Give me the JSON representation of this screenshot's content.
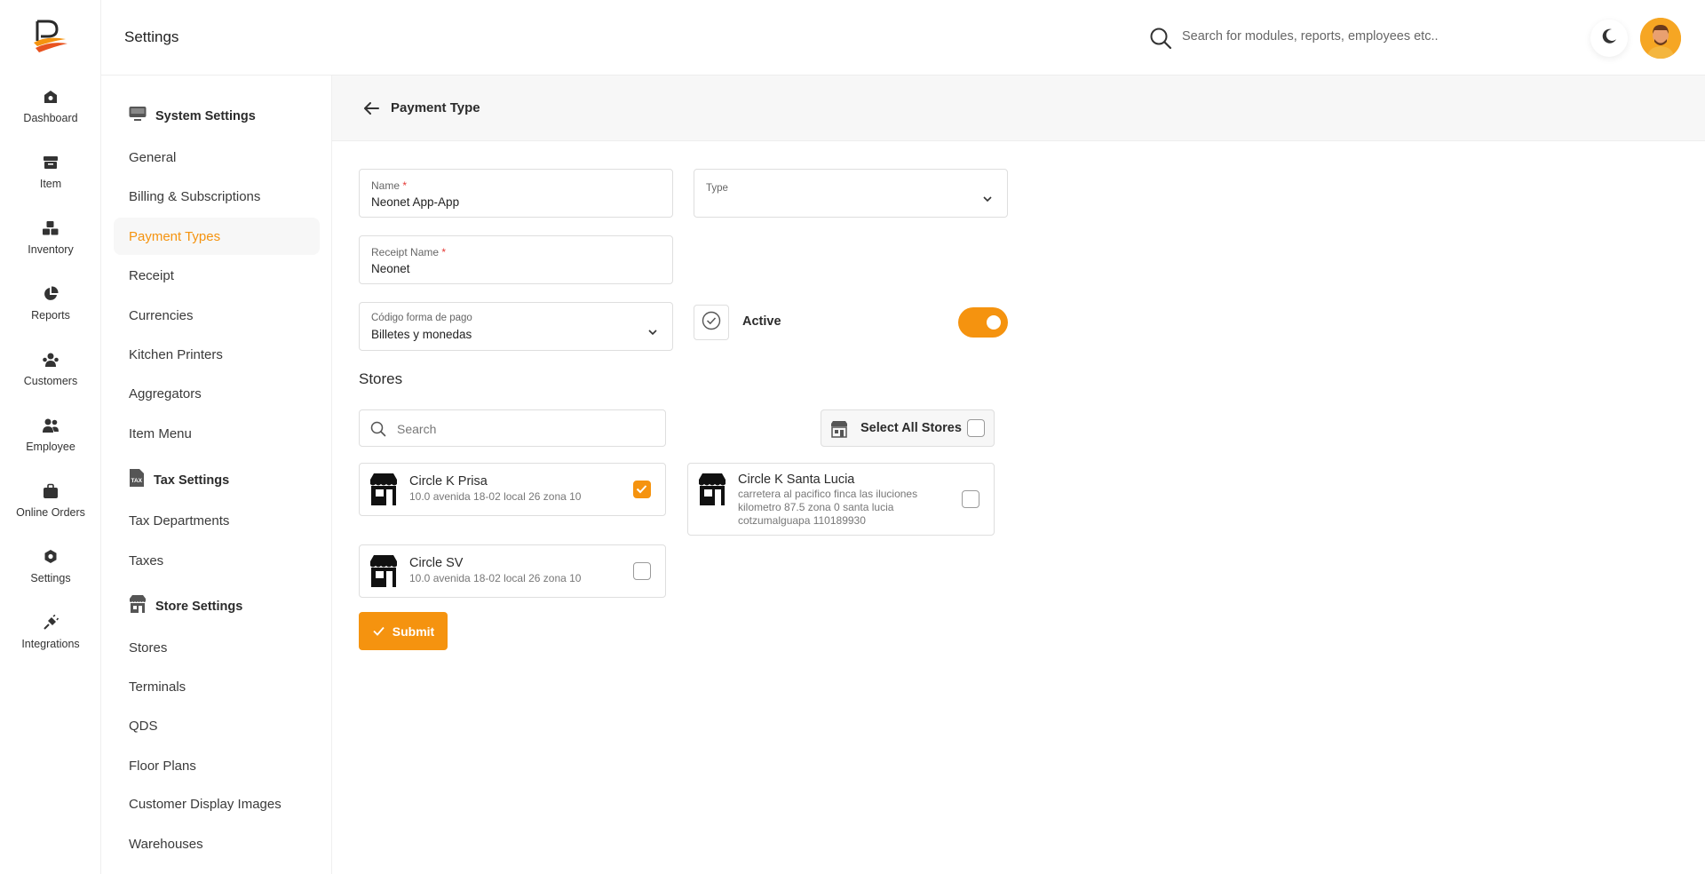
{
  "header": {
    "title": "Settings",
    "search_placeholder": "Search for modules, reports, employees etc.."
  },
  "rail": {
    "items": [
      {
        "label": "Dashboard",
        "icon": "dashboard-icon"
      },
      {
        "label": "Item",
        "icon": "item-icon"
      },
      {
        "label": "Inventory",
        "icon": "inventory-icon"
      },
      {
        "label": "Reports",
        "icon": "reports-icon"
      },
      {
        "label": "Customers",
        "icon": "customers-icon"
      },
      {
        "label": "Employee",
        "icon": "employee-icon"
      },
      {
        "label": "Online Orders",
        "icon": "online-orders-icon"
      },
      {
        "label": "Settings",
        "icon": "settings-icon"
      },
      {
        "label": "Integrations",
        "icon": "integrations-icon"
      }
    ]
  },
  "settings_nav": {
    "system_settings": "System Settings",
    "general": "General",
    "billing": "Billing & Subscriptions",
    "payment_types": "Payment Types",
    "receipt": "Receipt",
    "currencies": "Currencies",
    "kitchen_printers": "Kitchen Printers",
    "aggregators": "Aggregators",
    "item_menu": "Item Menu",
    "tax_settings": "Tax Settings",
    "tax_departments": "Tax Departments",
    "taxes": "Taxes",
    "store_settings": "Store Settings",
    "stores": "Stores",
    "terminals": "Terminals",
    "qds": "QDS",
    "floor_plans": "Floor Plans",
    "customer_display_images": "Customer Display Images",
    "warehouses": "Warehouses",
    "tax_icon_text": "TAX"
  },
  "page": {
    "title": "Payment Type"
  },
  "form": {
    "name_label": "Name",
    "name_value": "Neonet App-App",
    "type_label": "Type",
    "type_value": "",
    "receipt_name_label": "Receipt Name",
    "receipt_name_value": "Neonet",
    "codigo_label": "Código forma de pago",
    "codigo_value": "Billetes y monedas",
    "active_label": "Active",
    "active_on": true,
    "required_mark": "*"
  },
  "stores": {
    "title": "Stores",
    "search_placeholder": "Search",
    "select_all_label": "Select All Stores",
    "select_all_checked": false,
    "items": [
      {
        "name": "Circle K Prisa",
        "address": "10.0 avenida 18-02 local 26 zona 10",
        "checked": true
      },
      {
        "name": "Circle K Santa Lucia",
        "address": "carretera al pacifico finca las iluciones kilometro 87.5 zona 0 santa lucia cotzumalguapa 110189930",
        "checked": false
      },
      {
        "name": "Circle SV",
        "address": "10.0 avenida 18-02 local 26 zona 10",
        "checked": false
      }
    ]
  },
  "submit_label": "Submit",
  "colors": {
    "accent": "#f5930f",
    "required": "#e53935"
  }
}
